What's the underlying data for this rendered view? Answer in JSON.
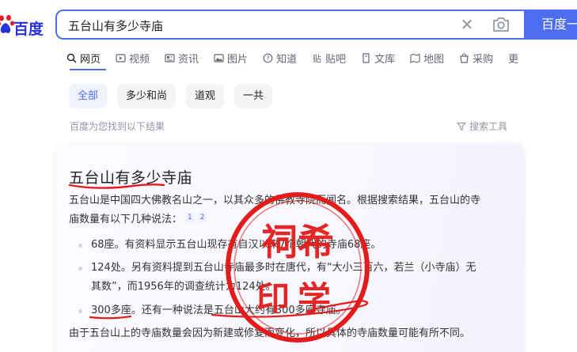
{
  "logo": {
    "text": "百度",
    "brand_color": "#2932e1"
  },
  "search": {
    "query": "五台山有多少寺庙",
    "button_label": "百度一",
    "accent": "#4e6ef2"
  },
  "tabs": [
    {
      "label": "网页",
      "icon": "search-icon",
      "active": true
    },
    {
      "label": "视频",
      "icon": "video-icon"
    },
    {
      "label": "资讯",
      "icon": "news-icon"
    },
    {
      "label": "图片",
      "icon": "image-icon"
    },
    {
      "label": "知道",
      "icon": "question-icon"
    },
    {
      "label": "贴吧",
      "icon": "tieba-icon"
    },
    {
      "label": "文库",
      "icon": "document-icon"
    },
    {
      "label": "地图",
      "icon": "map-icon"
    },
    {
      "label": "采购",
      "icon": "shopping-icon"
    },
    {
      "label": "更",
      "icon": "more-icon"
    }
  ],
  "chips": [
    "全部",
    "多少和尚",
    "道观",
    "一共"
  ],
  "result_count": "百度为您找到以下结果",
  "search_tools": "搜索工具",
  "card": {
    "title": "五台山有多少寺庙",
    "intro_line1": "五台山是中国四大佛教名山之一，以其众多的佛教寺院而闻名。根据搜索结果，五台山的寺",
    "intro_line2": "庙数量有以下几种说法：",
    "refs": [
      "1",
      "2"
    ],
    "items": [
      {
        "text": "68座。有资料显示五台山现存有自汉以来7个朝代的寺庙68座。"
      },
      {
        "line1": "124处。另有资料提到五台山寺庙最多时在唐代，有“大小三百六，若兰（小寺庙）无",
        "line2": "其数”，而1956年的调查统计为124处。"
      },
      {
        "text": "300多座。还有一种说法是五台山大约有300多座寺庙。"
      }
    ],
    "footer": "由于五台山上的寺庙数量会因为新建或修复而变化，所以具体的寺庙数量可能有所不同。"
  },
  "stamp": {
    "top": "祠希",
    "bottom": "印学",
    "color": "#e31b1b"
  }
}
